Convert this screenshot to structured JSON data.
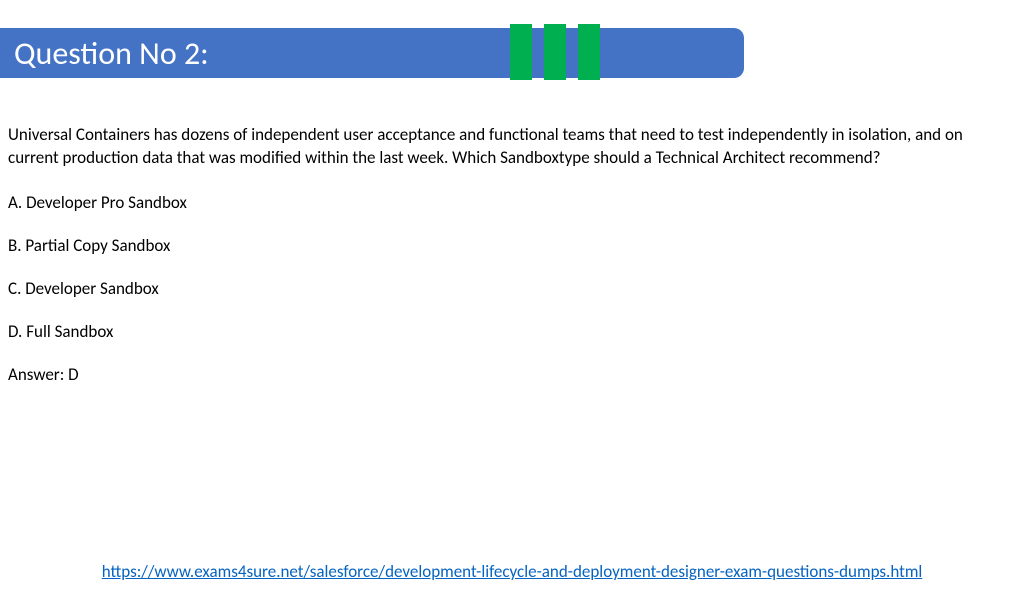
{
  "header": {
    "title": "Question No 2:"
  },
  "question": {
    "text": "Universal Containers has dozens of independent user acceptance and functional teams that need to test independently in isolation, and on current production data that was modified within the last week. Which Sandboxtype should a Technical Architect recommend?",
    "options": {
      "a": "A. Developer Pro Sandbox",
      "b": "B. Partial Copy Sandbox",
      "c": "C. Developer Sandbox",
      "d": "D. Full Sandbox"
    },
    "answer": "Answer: D"
  },
  "footer": {
    "link_text": "https://www.exams4sure.net/salesforce/development-lifecycle-and-deployment-designer-exam-questions-dumps.html"
  }
}
